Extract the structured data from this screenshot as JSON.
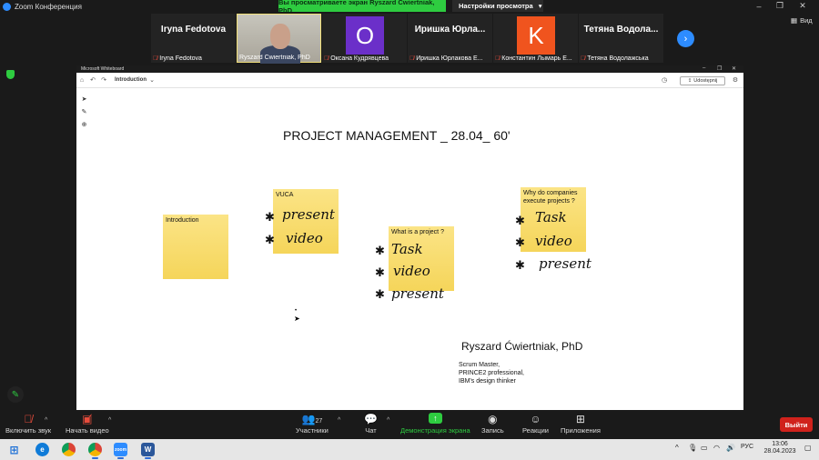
{
  "window": {
    "title": "Zoom Конференция",
    "share_banner": "Вы просматриваете экран Ryszard Ćwiertniak, PhD",
    "view_settings": "Настройки просмотра",
    "view_label": "Вид"
  },
  "participants": [
    {
      "big_name": "Iryna Fedotova",
      "caption": "Iryna Fedotova",
      "avatar": "",
      "avatar_color": ""
    },
    {
      "big_name": "",
      "caption": "Ryszard Ćwiertniak, PhD",
      "avatar": "",
      "avatar_color": "",
      "video": true
    },
    {
      "big_name": "",
      "caption": "Оксана Кудрявцева",
      "avatar": "O",
      "avatar_color": "#6b2fc9"
    },
    {
      "big_name": "Иришка Юрла...",
      "caption": "Иришка Юрлакова Е...",
      "avatar": "",
      "avatar_color": ""
    },
    {
      "big_name": "",
      "caption": "Константин Лымарь Е...",
      "avatar": "K",
      "avatar_color": "#f0541e"
    },
    {
      "big_name": "Тетяна Водола...",
      "caption": "Тетяна Водолажська",
      "avatar": "",
      "avatar_color": ""
    }
  ],
  "whiteboard": {
    "window_title": "Microsoft Whiteboard",
    "tab_name": "Introduction",
    "share_label": "Udostępnij",
    "heading": "PROJECT MANAGEMENT _ 28.04_ 60'",
    "notes": [
      {
        "text": "Introduction"
      },
      {
        "text": "VUCA"
      },
      {
        "text": "What is a project ?"
      },
      {
        "text": "Why do companies execute projects ?"
      }
    ],
    "ink": {
      "vuca": [
        "present",
        "video"
      ],
      "project": [
        "Task",
        "video",
        "present"
      ],
      "why": [
        "Task",
        "video",
        "present"
      ]
    },
    "presenter": "Ryszard Ćwiertniak, PhD",
    "bio": [
      "Scrum Master,",
      "PRINCE2 professional,",
      "IBM's design thinker"
    ]
  },
  "toolbar": {
    "audio": "Включить звук",
    "video": "Начать видео",
    "participants_count": "27",
    "participants": "Участники",
    "chat": "Чат",
    "share": "Демонстрация экрана",
    "record": "Запись",
    "reactions": "Реакции",
    "apps": "Приложения",
    "leave": "Выйти"
  },
  "taskbar": {
    "lang": "РУС",
    "time": "13:06",
    "date": "28.04.2023"
  }
}
